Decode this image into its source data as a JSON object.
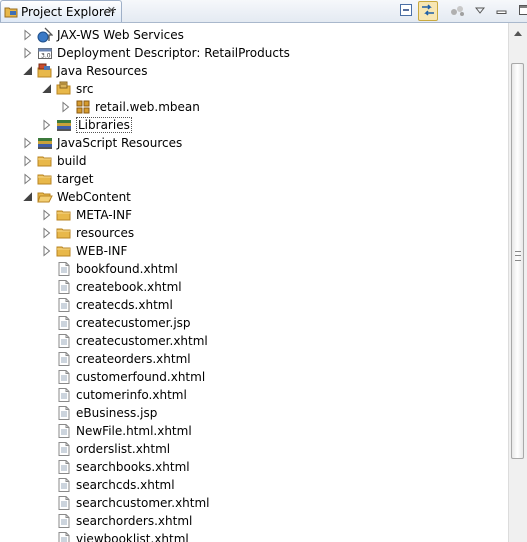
{
  "view": {
    "title": "Project Explorer",
    "close_glyph": "✕",
    "toolbar": [
      {
        "name": "collapse-all-icon",
        "pressed": false
      },
      {
        "name": "link-with-editor-icon",
        "pressed": true
      },
      {
        "name": "view-menu-dots-icon",
        "pressed": false
      },
      {
        "name": "view-menu-icon",
        "pressed": false
      },
      {
        "name": "minimize-icon",
        "pressed": false
      },
      {
        "name": "maximize-icon",
        "pressed": false
      }
    ]
  },
  "tree": [
    {
      "label": "JAX-WS Web Services",
      "depth": 0,
      "twisty": "collapsed",
      "icon": "webservice-icon"
    },
    {
      "label": "Deployment Descriptor: RetailProducts",
      "depth": 0,
      "twisty": "collapsed",
      "icon": "deployment-descriptor-icon"
    },
    {
      "label": "Java Resources",
      "depth": 0,
      "twisty": "expanded",
      "icon": "java-resources-icon"
    },
    {
      "label": "src",
      "depth": 1,
      "twisty": "expanded",
      "icon": "source-folder-icon"
    },
    {
      "label": "retail.web.mbean",
      "depth": 2,
      "twisty": "collapsed",
      "icon": "package-icon"
    },
    {
      "label": "Libraries",
      "depth": 1,
      "twisty": "collapsed",
      "icon": "libraries-icon",
      "focused": true
    },
    {
      "label": "JavaScript Resources",
      "depth": 0,
      "twisty": "collapsed",
      "icon": "libraries-icon"
    },
    {
      "label": "build",
      "depth": 0,
      "twisty": "collapsed",
      "icon": "folder-icon"
    },
    {
      "label": "target",
      "depth": 0,
      "twisty": "collapsed",
      "icon": "folder-icon"
    },
    {
      "label": "WebContent",
      "depth": 0,
      "twisty": "expanded",
      "icon": "folder-open-icon"
    },
    {
      "label": "META-INF",
      "depth": 1,
      "twisty": "collapsed",
      "icon": "folder-icon"
    },
    {
      "label": "resources",
      "depth": 1,
      "twisty": "collapsed",
      "icon": "folder-icon"
    },
    {
      "label": "WEB-INF",
      "depth": 1,
      "twisty": "collapsed",
      "icon": "folder-icon"
    },
    {
      "label": "bookfound.xhtml",
      "depth": 1,
      "twisty": "none",
      "icon": "file-icon"
    },
    {
      "label": "createbook.xhtml",
      "depth": 1,
      "twisty": "none",
      "icon": "file-icon"
    },
    {
      "label": "createcds.xhtml",
      "depth": 1,
      "twisty": "none",
      "icon": "file-icon"
    },
    {
      "label": "createcustomer.jsp",
      "depth": 1,
      "twisty": "none",
      "icon": "file-icon"
    },
    {
      "label": "createcustomer.xhtml",
      "depth": 1,
      "twisty": "none",
      "icon": "file-icon"
    },
    {
      "label": "createorders.xhtml",
      "depth": 1,
      "twisty": "none",
      "icon": "file-icon"
    },
    {
      "label": "customerfound.xhtml",
      "depth": 1,
      "twisty": "none",
      "icon": "file-icon"
    },
    {
      "label": "cutomerinfo.xhtml",
      "depth": 1,
      "twisty": "none",
      "icon": "file-icon"
    },
    {
      "label": "eBusiness.jsp",
      "depth": 1,
      "twisty": "none",
      "icon": "file-icon"
    },
    {
      "label": "NewFile.html.xhtml",
      "depth": 1,
      "twisty": "none",
      "icon": "file-icon"
    },
    {
      "label": "orderslist.xhtml",
      "depth": 1,
      "twisty": "none",
      "icon": "file-icon"
    },
    {
      "label": "searchbooks.xhtml",
      "depth": 1,
      "twisty": "none",
      "icon": "file-icon"
    },
    {
      "label": "searchcds.xhtml",
      "depth": 1,
      "twisty": "none",
      "icon": "file-icon"
    },
    {
      "label": "searchcustomer.xhtml",
      "depth": 1,
      "twisty": "none",
      "icon": "file-icon"
    },
    {
      "label": "searchorders.xhtml",
      "depth": 1,
      "twisty": "none",
      "icon": "file-icon"
    },
    {
      "label": "viewbooklist.xhtml",
      "depth": 1,
      "twisty": "none",
      "icon": "file-icon"
    }
  ],
  "colors": {
    "folder": "#e8b84a",
    "folder_dark": "#b98523",
    "twisty": "#7a7a7a"
  }
}
